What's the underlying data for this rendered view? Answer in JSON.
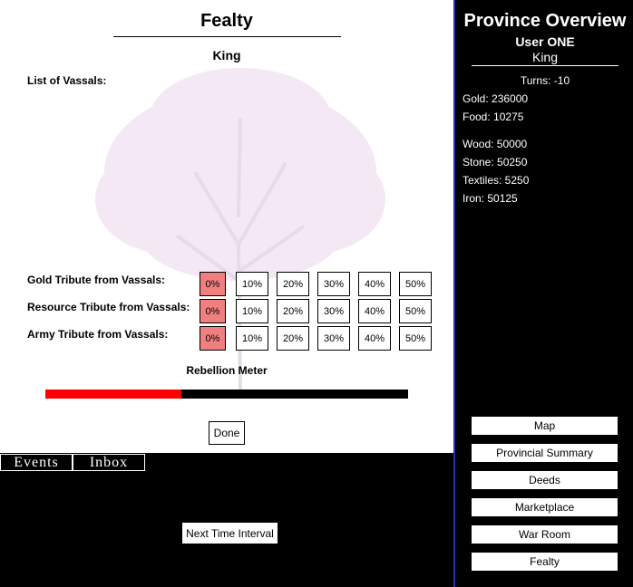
{
  "main": {
    "title": "Fealty",
    "subtitle": "King",
    "vassals_label": "List of Vassals:",
    "tribute_rows": [
      {
        "label": "Gold Tribute from Vassals:",
        "options": [
          "0%",
          "10%",
          "20%",
          "30%",
          "40%",
          "50%"
        ],
        "selected": 0
      },
      {
        "label": "Resource Tribute from Vassals:",
        "options": [
          "0%",
          "10%",
          "20%",
          "30%",
          "40%",
          "50%"
        ],
        "selected": 0
      },
      {
        "label": "Army Tribute from Vassals:",
        "options": [
          "0%",
          "10%",
          "20%",
          "30%",
          "40%",
          "50%"
        ],
        "selected": 0
      }
    ],
    "rebellion_label": "Rebellion Meter",
    "rebellion_level": 0.375,
    "done_label": "Done"
  },
  "tabs": {
    "events": "Events",
    "inbox": "Inbox"
  },
  "bottom": {
    "next_label": "Next Time Interval"
  },
  "sidebar": {
    "title": "Province Overview",
    "user": "User ONE",
    "rank": "King",
    "turns": "Turns: -10",
    "resources_a": [
      "Gold: 236000",
      "Food: 10275"
    ],
    "resources_b": [
      "Wood: 50000",
      "Stone: 50250",
      "Textiles: 5250",
      "Iron: 50125"
    ],
    "nav": [
      "Map",
      "Provincial Summary",
      "Deeds",
      "Marketplace",
      "War Room",
      "Fealty"
    ]
  },
  "colors": {
    "selected": "#f08080",
    "meter_fill": "#ff0000",
    "sidebar_border": "#2233bb",
    "tree": "#f0e4f4"
  }
}
